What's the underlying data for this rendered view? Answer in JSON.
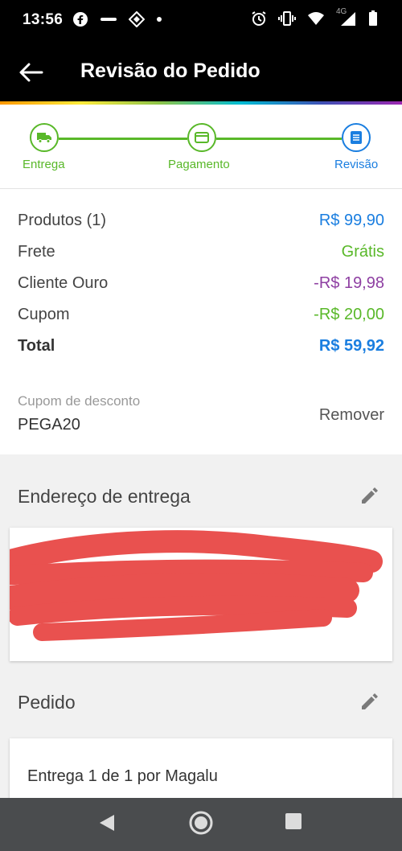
{
  "status_bar": {
    "time": "13:56",
    "network": "4G"
  },
  "app_bar": {
    "title": "Revisão do Pedido"
  },
  "stepper": {
    "steps": [
      {
        "label": "Entrega",
        "icon": "truck-icon",
        "state": "done"
      },
      {
        "label": "Pagamento",
        "icon": "credit-card-icon",
        "state": "done"
      },
      {
        "label": "Revisão",
        "icon": "document-icon",
        "state": "active"
      }
    ]
  },
  "summary": {
    "rows": [
      {
        "label": "Produtos (1)",
        "value": "R$ 99,90",
        "color": "#1a7ee0"
      },
      {
        "label": "Frete",
        "value": "Grátis",
        "color": "#59b829"
      },
      {
        "label": "Cliente Ouro",
        "value": "-R$ 19,98",
        "color": "#8e3fa2"
      },
      {
        "label": "Cupom",
        "value": "-R$ 20,00",
        "color": "#59b829"
      }
    ],
    "total_label": "Total",
    "total_value": "R$ 59,92",
    "total_color": "#1a7ee0"
  },
  "coupon": {
    "label": "Cupom de desconto",
    "code": "PEGA20",
    "remove_label": "Remover"
  },
  "address": {
    "title": "Endereço de entrega",
    "redacted": true,
    "redaction_color": "#e9514f"
  },
  "order": {
    "title": "Pedido",
    "delivery_text": "Entrega 1 de 1 por Magalu"
  },
  "colors": {
    "accent_green": "#59b829",
    "accent_blue": "#1a7ee0"
  }
}
